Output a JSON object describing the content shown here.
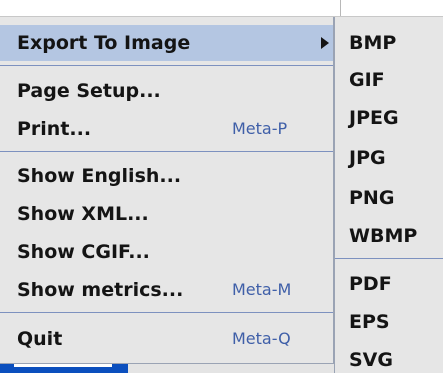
{
  "menu": {
    "export_to_image": "Export To Image",
    "page_setup": "Page Setup...",
    "print": {
      "label": "Print...",
      "shortcut": "Meta-P"
    },
    "show_english": "Show English...",
    "show_xml": "Show XML...",
    "show_cgif": "Show CGIF...",
    "show_metrics": {
      "label": "Show metrics...",
      "shortcut": "Meta-M"
    },
    "quit": {
      "label": "Quit",
      "shortcut": "Meta-Q"
    }
  },
  "submenu": {
    "items": [
      "BMP",
      "GIF",
      "JPEG",
      "JPG",
      "PNG",
      "WBMP",
      "PDF",
      "EPS",
      "SVG"
    ]
  },
  "colors": {
    "selected_item_bg": "#b4c6e2",
    "menu_bg": "#e6e6e6",
    "shortcut_text": "#3f5fa8",
    "separator": "#7d91bf"
  }
}
